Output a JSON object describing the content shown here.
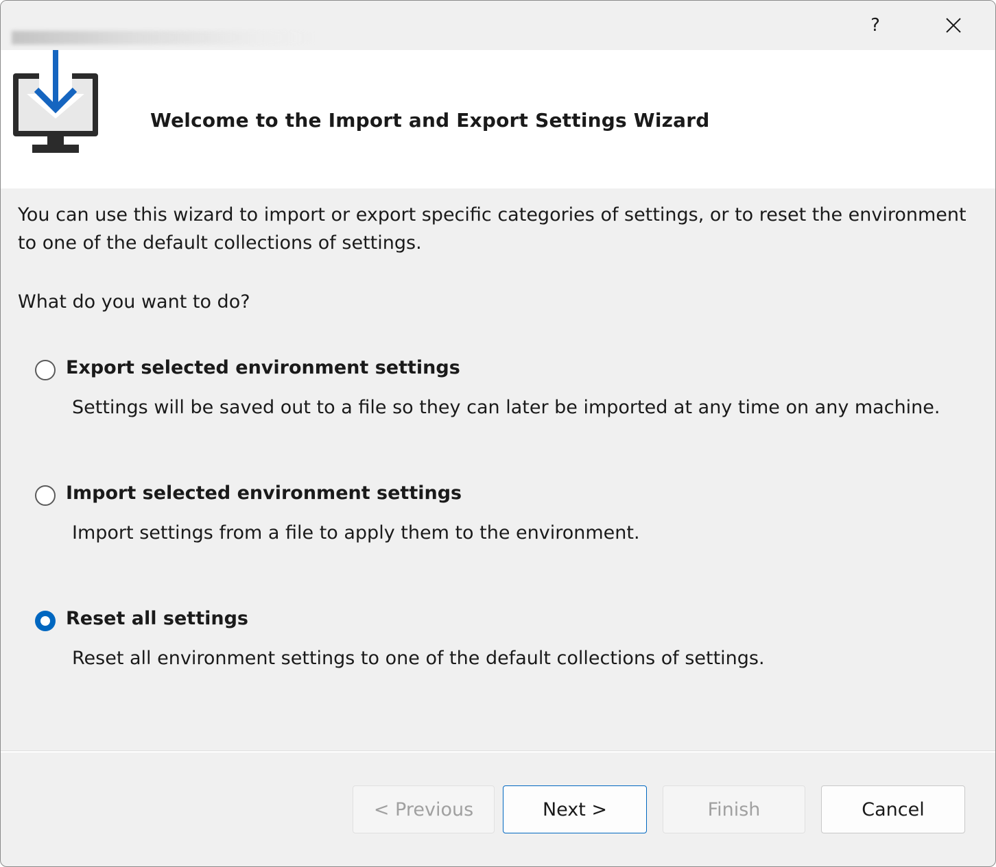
{
  "titlebar": {
    "help_label": "?",
    "close_icon": "close-icon"
  },
  "header": {
    "icon": "monitor-download-icon",
    "title": "Welcome to the Import and Export Settings Wizard"
  },
  "content": {
    "intro": "You can use this wizard to import or export specific categories of settings, or to reset the environment to one of the default collections of settings.",
    "question": "What do you want to do?",
    "options": [
      {
        "label": "Export selected environment settings",
        "description": "Settings will be saved out to a file so they can later be imported at any time on any machine.",
        "selected": false
      },
      {
        "label": "Import selected environment settings",
        "description": "Import settings from a file to apply them to the environment.",
        "selected": false
      },
      {
        "label": "Reset all settings",
        "description": "Reset all environment settings to one of the default collections of settings.",
        "selected": true
      }
    ]
  },
  "footer": {
    "previous_label": "< Previous",
    "next_label": "Next >",
    "finish_label": "Finish",
    "cancel_label": "Cancel"
  },
  "colors": {
    "accent": "#0067c0",
    "window_bg": "#f0f0f0",
    "header_bg": "#ffffff",
    "disabled_text": "#a0a0a0"
  }
}
